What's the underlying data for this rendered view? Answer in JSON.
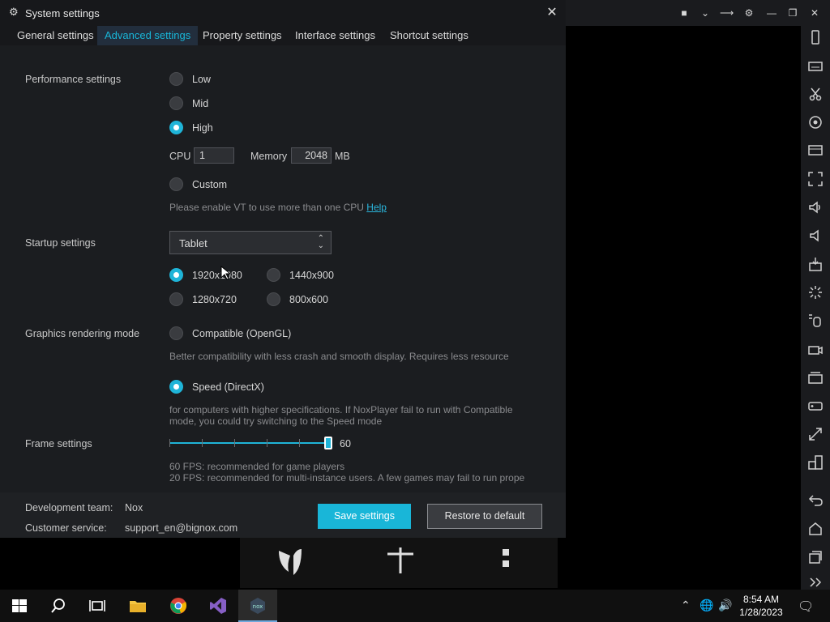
{
  "dialog": {
    "title": "System settings",
    "tabs": [
      {
        "label": "General settings"
      },
      {
        "label": "Advanced settings",
        "active": true
      },
      {
        "label": "Property settings"
      },
      {
        "label": "Interface settings"
      },
      {
        "label": "Shortcut settings"
      }
    ]
  },
  "performance": {
    "label": "Performance settings",
    "options": [
      "Low",
      "Mid",
      "High",
      "Custom"
    ],
    "selected": "High",
    "cpu_label": "CPU",
    "cpu_value": "1",
    "memory_label": "Memory",
    "memory_value": "2048",
    "memory_unit": "MB",
    "vt_note": "Please enable VT to use more than one CPU",
    "help_link": "Help"
  },
  "startup": {
    "label": "Startup settings",
    "mode": "Tablet",
    "resolutions": [
      "1920x1080",
      "1440x900",
      "1280x720",
      "800x600"
    ],
    "selected": "1920x1080"
  },
  "graphics": {
    "label": "Graphics rendering mode",
    "opt1": "Compatible (OpenGL)",
    "opt1_note": "Better compatibility with less crash and smooth display. Requires less resource",
    "opt2": "Speed (DirectX)",
    "opt2_note_1": "for computers with higher specifications. If NoxPlayer fail to run with Compatible",
    "opt2_note_2": "mode, you could try switching to the Speed mode",
    "selected": "Speed (DirectX)"
  },
  "frame": {
    "label": "Frame settings",
    "value": "60",
    "note1": "60 FPS: recommended for game players",
    "note2": "20 FPS: recommended for multi-instance users. A few games may fail to run prope"
  },
  "footer": {
    "dev_label": "Development team:",
    "dev_value": "Nox",
    "cs_label": "Customer service:",
    "cs_value": "support_en@bignox.com",
    "save": "Save settings",
    "restore": "Restore to default"
  },
  "taskbar": {
    "time": "8:54 AM",
    "date": "1/28/2023"
  },
  "colors": {
    "accent": "#19b6d8",
    "dialog_bg": "#1b1d20"
  }
}
